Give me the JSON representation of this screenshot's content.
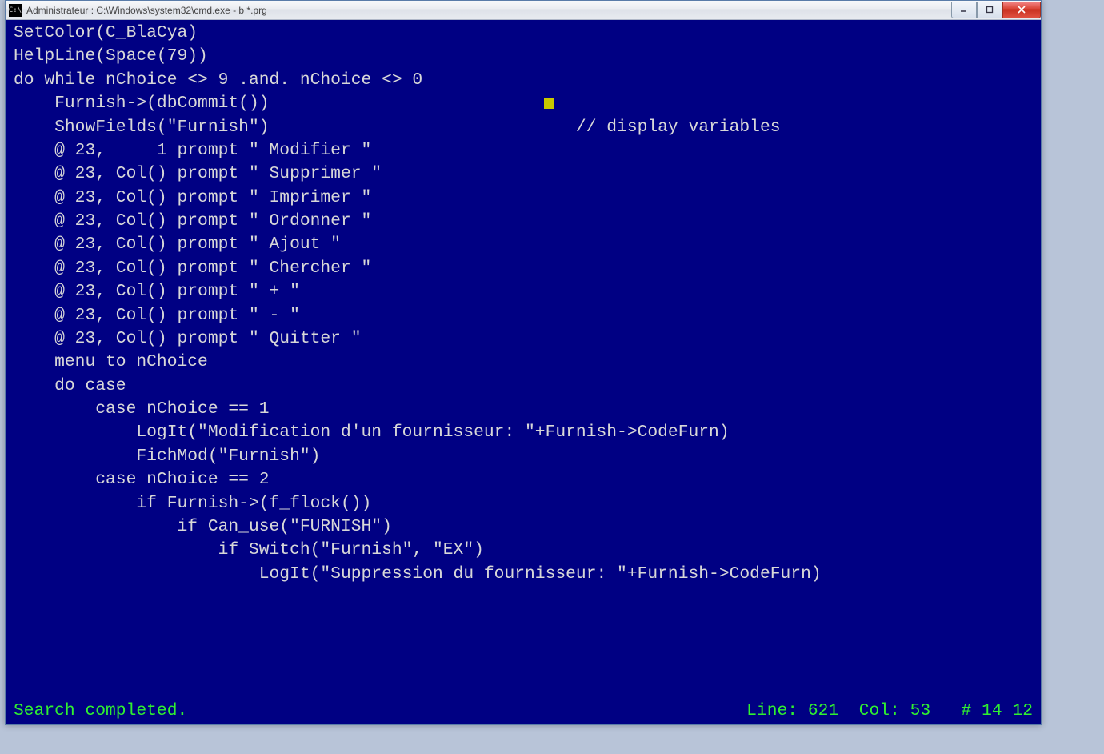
{
  "window": {
    "title": "Administrateur : C:\\Windows\\system32\\cmd.exe - b  *.prg",
    "icon_label": "cmd-icon"
  },
  "code": {
    "lines": [
      "SetColor(C_BlaCya)",
      "HelpLine(Space(79))",
      "do while nChoice <> 9 .and. nChoice <> 0",
      "    Furnish->(dbCommit())",
      "    ShowFields(\"Furnish\")                              // display variables",
      "    @ 23,     1 prompt \" Modifier \"",
      "    @ 23, Col() prompt \" Supprimer \"",
      "    @ 23, Col() prompt \" Imprimer \"",
      "    @ 23, Col() prompt \" Ordonner \"",
      "    @ 23, Col() prompt \" Ajout \"",
      "    @ 23, Col() prompt \" Chercher \"",
      "    @ 23, Col() prompt \" + \"",
      "    @ 23, Col() prompt \" - \"",
      "    @ 23, Col() prompt \" Quitter \"",
      "    menu to nChoice",
      "    do case",
      "        case nChoice == 1",
      "            LogIt(\"Modification d'un fournisseur: \"+Furnish->CodeFurn)",
      "            FichMod(\"Furnish\")",
      "        case nChoice == 2",
      "            if Furnish->(f_flock())",
      "                if Can_use(\"FURNISH\")",
      "                    if Switch(\"Furnish\", \"EX\")",
      "                        LogIt(\"Suppression du fournisseur: \"+Furnish->CodeFurn)"
    ]
  },
  "cursor": {
    "line_index": 3,
    "col_spaces": "                                                    "
  },
  "status": {
    "left": "Search completed.",
    "right": "Line: 621  Col: 53   # 14 12"
  }
}
